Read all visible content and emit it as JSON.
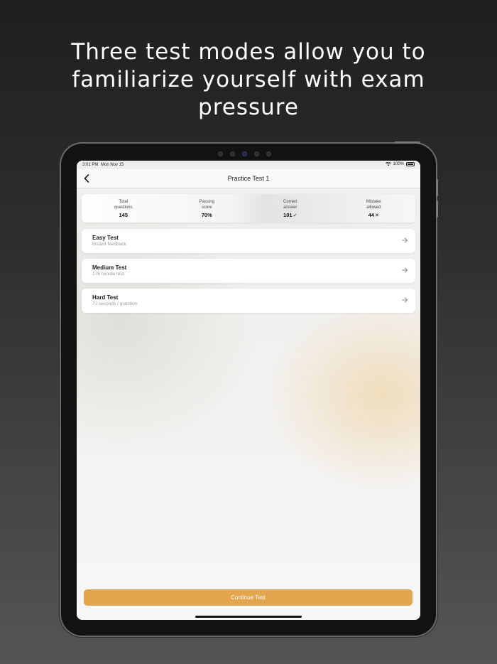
{
  "headline": {
    "line1": "Three test modes allow you to",
    "line2": "familiarize yourself with exam",
    "line3": "pressure"
  },
  "status_bar": {
    "time": "3:01 PM",
    "date": "Mon Nov 15",
    "battery": "100%"
  },
  "nav": {
    "title": "Practice Test 1"
  },
  "stats": [
    {
      "label_line1": "Total",
      "label_line2": "questions",
      "value": "145",
      "suffix": ""
    },
    {
      "label_line1": "Passing",
      "label_line2": "score",
      "value": "70%",
      "suffix": ""
    },
    {
      "label_line1": "Correct",
      "label_line2": "answer",
      "value": "101",
      "suffix": "✓"
    },
    {
      "label_line1": "Mistake",
      "label_line2": "allowed",
      "value": "44",
      "suffix": "✕"
    }
  ],
  "modes": [
    {
      "title": "Easy Test",
      "subtitle": "Instant feedback"
    },
    {
      "title": "Medium Test",
      "subtitle": "176 minute test"
    },
    {
      "title": "Hard Test",
      "subtitle": "72 seconds / question"
    }
  ],
  "continue_label": "Continue Test",
  "colors": {
    "accent": "#e3a54e",
    "text_primary": "#1a1a1a",
    "text_secondary": "#9a9a9a"
  }
}
